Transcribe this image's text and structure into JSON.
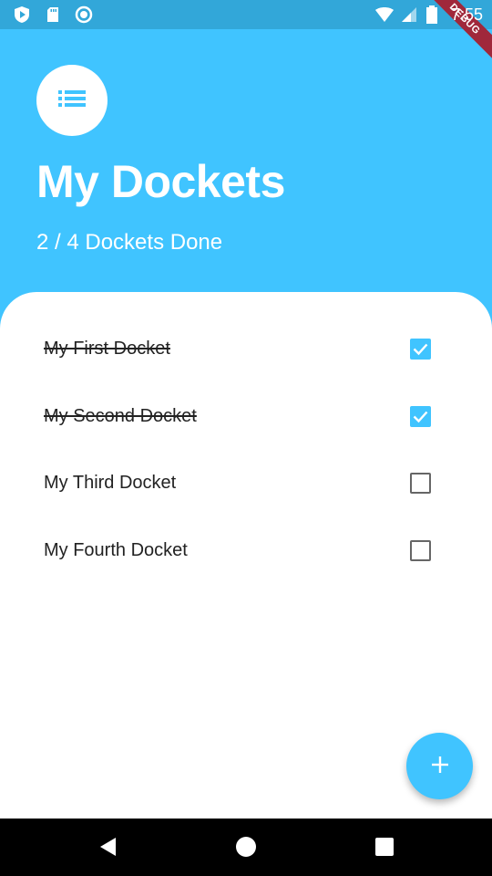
{
  "status_bar": {
    "time": "7:55",
    "icons": [
      "play-protect-icon",
      "sd-card-icon",
      "sync-icon",
      "wifi-icon",
      "signal-icon",
      "battery-icon"
    ]
  },
  "debug_banner": "DEBUG",
  "header": {
    "avatar_icon": "list-icon",
    "title": "My Dockets",
    "subtitle": "2 / 4 Dockets Done"
  },
  "dockets": [
    {
      "label": "My First Docket",
      "done": true
    },
    {
      "label": "My Second Docket",
      "done": true
    },
    {
      "label": "My Third Docket",
      "done": false
    },
    {
      "label": "My Fourth Docket",
      "done": false
    }
  ],
  "fab": {
    "icon": "plus-icon"
  },
  "nav_bar": {
    "icons": [
      "back-icon",
      "home-icon",
      "recents-icon"
    ]
  },
  "colors": {
    "accent": "#40c4ff",
    "status_bar": "#32a7d9",
    "debug": "#a0283b"
  }
}
